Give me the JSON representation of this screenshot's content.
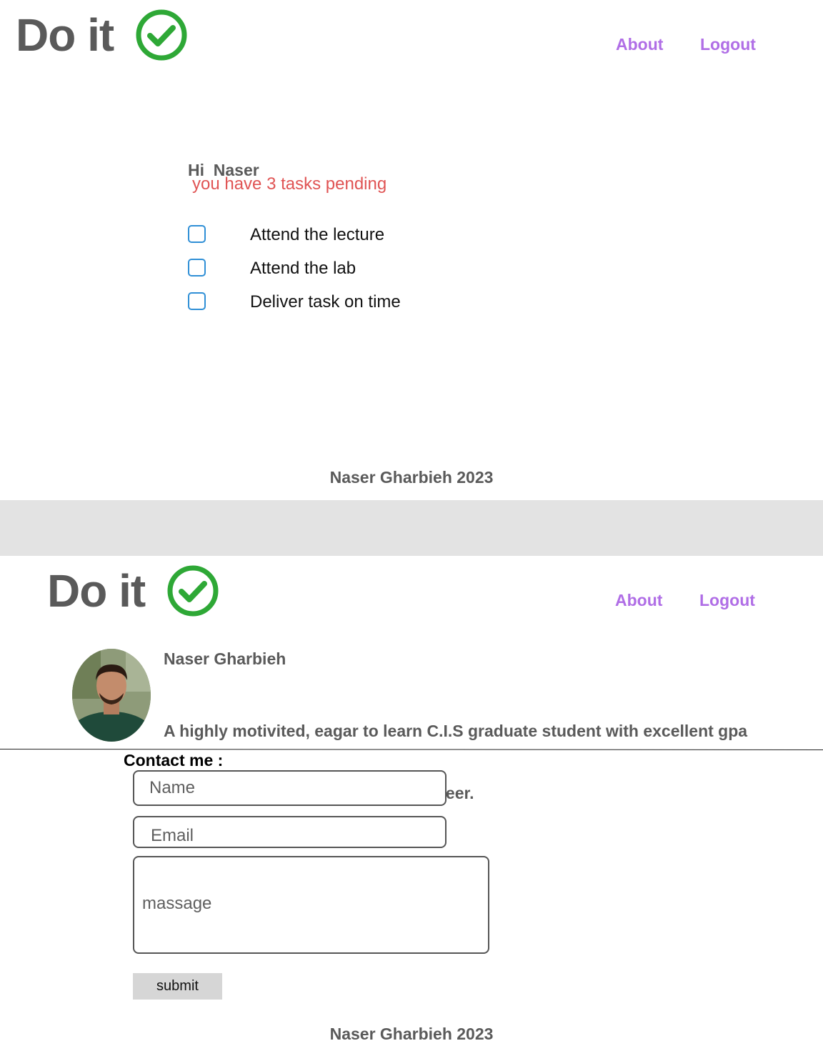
{
  "screen1": {
    "logo_text": "Do it",
    "nav": {
      "about": "About",
      "logout": "Logout"
    },
    "greeting": "Hi  Naser",
    "pending": "you have 3 tasks pending",
    "tasks": [
      {
        "label": "Attend the lecture",
        "checked": false
      },
      {
        "label": "Attend the lab",
        "checked": false
      },
      {
        "label": "Deliver task on time",
        "checked": false
      }
    ],
    "footer": "Naser Gharbieh 2023"
  },
  "screen2": {
    "logo_text": "Do it",
    "nav": {
      "about": "About",
      "logout": "Logout"
    },
    "profile": {
      "name": "Naser Gharbieh",
      "bio_line1": "A highly motivited, eagar to learn C.I.S graduate student with excellent gpa",
      "bio_line2": " looking to be a  java software engineer."
    },
    "contact": {
      "label": "Contact me :",
      "name_placeholder": "Name",
      "email_placeholder": "Email",
      "message_placeholder": "massage",
      "submit_label": "submit"
    },
    "footer": "Naser Gharbieh 2023"
  },
  "colors": {
    "nav_link": "#b06ee6",
    "check_green": "#2ea836",
    "pending_red": "#e05454",
    "checkbox_blue": "#2f8fd6",
    "text_gray": "#5a5a5a",
    "band_gray": "#e3e3e3"
  },
  "icons": {
    "logo_check": "check-circle-icon"
  }
}
